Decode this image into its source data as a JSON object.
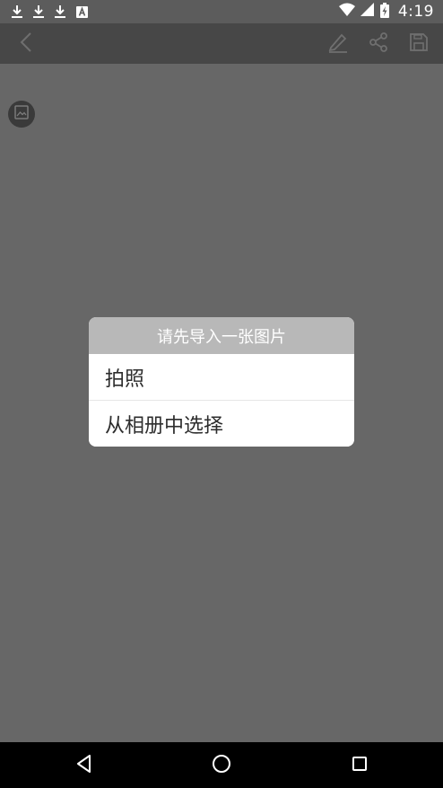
{
  "status_bar": {
    "time": "4:19",
    "notification_icons": [
      "download-icon",
      "download-icon",
      "download-icon",
      "font-a-icon"
    ],
    "system_icons": [
      "wifi-icon",
      "cell-signal-icon",
      "battery-charging-icon"
    ]
  },
  "app_bar": {
    "back_icon": "chevron-left-icon",
    "actions": [
      "edit-icon",
      "share-icon",
      "save-icon"
    ]
  },
  "content": {
    "image_placeholder_icon": "image-icon"
  },
  "dialog": {
    "title": "请先导入一张图片",
    "options": [
      "拍照",
      "从相册中选择"
    ],
    "title_bg": "#b8b8b8"
  },
  "nav_bar": {
    "buttons": [
      "back-triangle-icon",
      "home-circle-icon",
      "recents-square-icon"
    ]
  },
  "colors": {
    "overlay_bg": "#676767",
    "app_bar_bg": "#474747",
    "nav_bar_bg": "#000000"
  }
}
